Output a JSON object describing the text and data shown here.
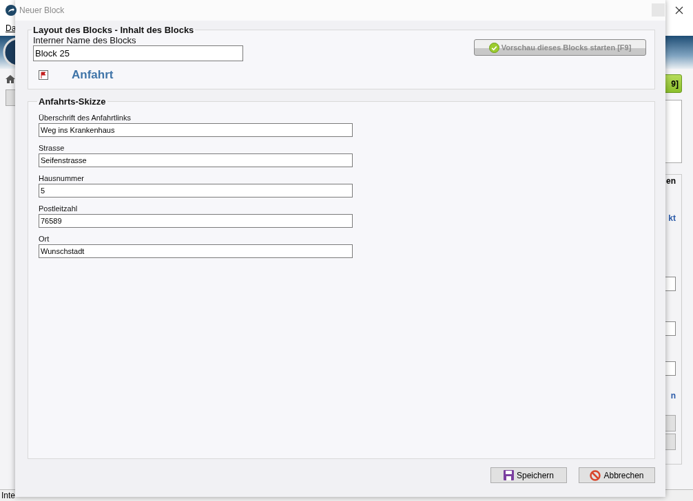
{
  "background_window": {
    "menu_item": "Da",
    "header_button": "9]",
    "section_heading": "en",
    "link_top": "kt",
    "link_bottom": "n",
    "status_bar": "Inte"
  },
  "dialog": {
    "title": "Neuer Block",
    "layout_group": {
      "legend": "Layout des Blocks - Inhalt des Blocks",
      "name_label": "Interner Name des Blocks",
      "name_value": "Block 25",
      "preview_button": {
        "label": "Vorschau dieses Blocks starten [F9]",
        "disabled": true
      },
      "block_type": "Anfahrt"
    },
    "sketch_group": {
      "legend": "Anfahrts-Skizze",
      "fields": [
        {
          "label": "Überschrift des Anfahrtlinks",
          "value": "Weg ins Krankenhaus"
        },
        {
          "label": "Strasse",
          "value": "Seifenstrasse"
        },
        {
          "label": "Hausnummer",
          "value": "5"
        },
        {
          "label": "Postleitzahl",
          "value": "76589"
        },
        {
          "label": "Ort",
          "value": "Wunschstadt"
        }
      ]
    },
    "buttons": [
      {
        "kind": "save",
        "label": "Speichern"
      },
      {
        "kind": "cancel",
        "label": "Abbrechen"
      }
    ]
  }
}
